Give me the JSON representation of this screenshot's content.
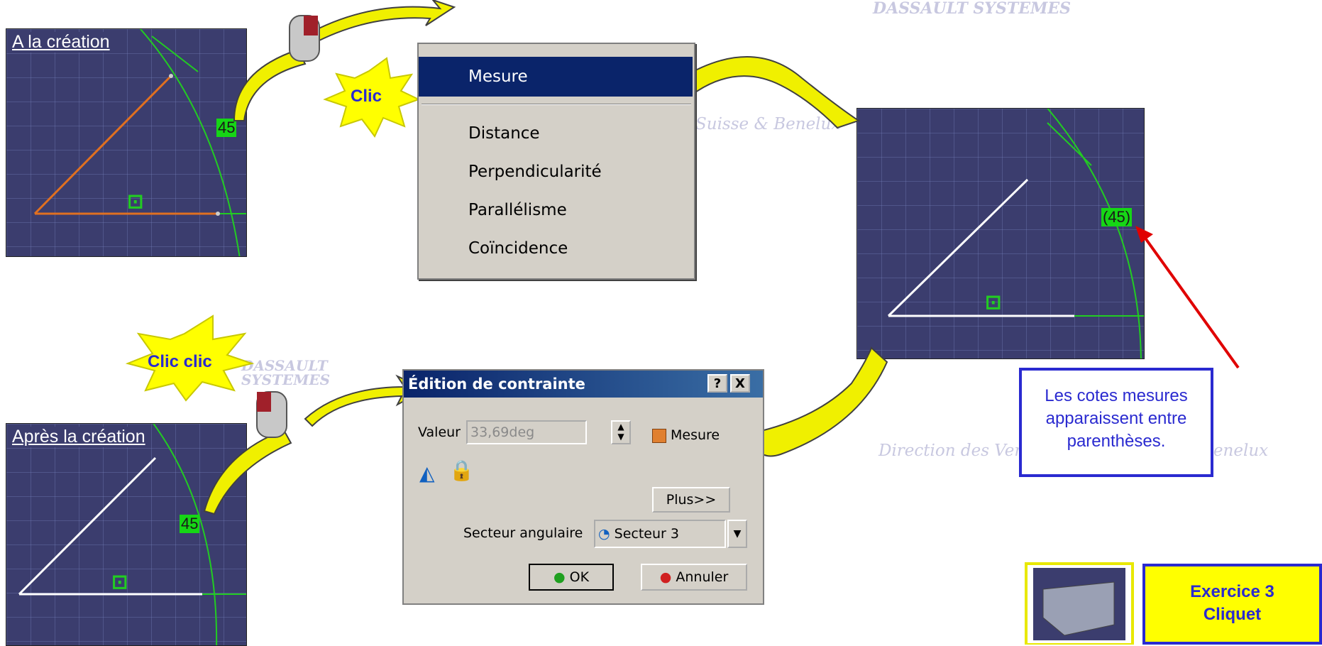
{
  "viewport_top_left": {
    "title": "A la création",
    "dimension": "45"
  },
  "viewport_bottom_left": {
    "title": "Après la création",
    "dimension": "45"
  },
  "viewport_right": {
    "dimension": "(45)"
  },
  "bursts": {
    "clic": "Clic",
    "clic_clic": "Clic clic"
  },
  "context_menu": {
    "items": [
      "Mesure",
      "Distance",
      "Perpendicularité",
      "Parallélisme",
      "Coïncidence"
    ],
    "selected_index": 0
  },
  "dialog": {
    "title": "Édition de contrainte",
    "help_button": "?",
    "close_button": "X",
    "value_label": "Valeur",
    "value": "33,69deg",
    "measure_checkbox_label": "Mesure",
    "more_button": "Plus>>",
    "sector_label": "Secteur angulaire",
    "sector_value": "Secteur 3",
    "ok_button": "OK",
    "cancel_button": "Annuler"
  },
  "callout": "Les cotes mesures apparaissent entre parenthèses.",
  "exercise_box": {
    "line1": "Exercice 3",
    "line2": "Cliquet"
  },
  "watermarks": {
    "logo_top": "DASSAULT SYSTEMES",
    "logo_mid": "DASSAULT SYSTEMES",
    "text_menu": "Suisse & Benelux",
    "text_right": "Direction des Ventes France, Suisse & Benelux"
  },
  "colors": {
    "viewport_bg": "#3b3d6e",
    "dimension_green": "#16d616",
    "selection_blue": "#0a246a",
    "callout_blue": "#2a2ad0",
    "arrow_yellow": "#f0f000",
    "highlight_red": "#e00000"
  }
}
